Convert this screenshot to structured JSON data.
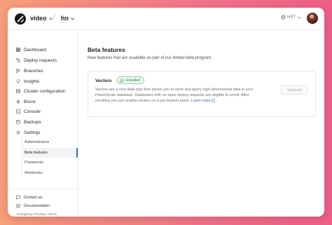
{
  "topbar": {
    "org_name": "video",
    "separator": "/",
    "database_name": "hn",
    "region": "HST",
    "logo_icon": "planetscale-logo-icon",
    "region_icon": "globe-icon"
  },
  "sidebar": {
    "items": [
      {
        "label": "Dashboard",
        "icon": "dashboard-icon"
      },
      {
        "label": "Deploy requests",
        "icon": "deploy-icon"
      },
      {
        "label": "Branches",
        "icon": "branch-icon"
      },
      {
        "label": "Insights",
        "icon": "insights-icon"
      },
      {
        "label": "Cluster configuration",
        "icon": "cluster-icon"
      },
      {
        "label": "Boost",
        "icon": "boost-icon"
      },
      {
        "label": "Console",
        "icon": "console-icon"
      },
      {
        "label": "Backups",
        "icon": "backups-icon"
      },
      {
        "label": "Settings",
        "icon": "gear-icon"
      }
    ],
    "settings_sub": [
      {
        "label": "Administrators"
      },
      {
        "label": "Beta features",
        "active": true
      },
      {
        "label": "Passwords"
      },
      {
        "label": "Webhooks"
      }
    ],
    "footer": {
      "contact": "Contact us",
      "docs": "Documentation",
      "legal": "Changelog • Privacy • Terms"
    }
  },
  "main": {
    "title": "Beta features",
    "subtitle": "New features that are available as part of our limited beta program.",
    "feature": {
      "name": "Vectors",
      "status": "Enrolled",
      "description": "Vectors are a new data type that allows you to store and query high-dimensional data in your PlanetScale database. Databases with no open deploy requests are eligible to enroll. After enrolling you can enable vectors on a per-branch basis.",
      "learn_more": "Learn more",
      "action": "Unenroll"
    }
  },
  "colors": {
    "accent": "#3b6fd0",
    "link": "#2563c9",
    "success": "#237a3c",
    "background_start": "#f8a07a",
    "background_end": "#ee5f86"
  }
}
